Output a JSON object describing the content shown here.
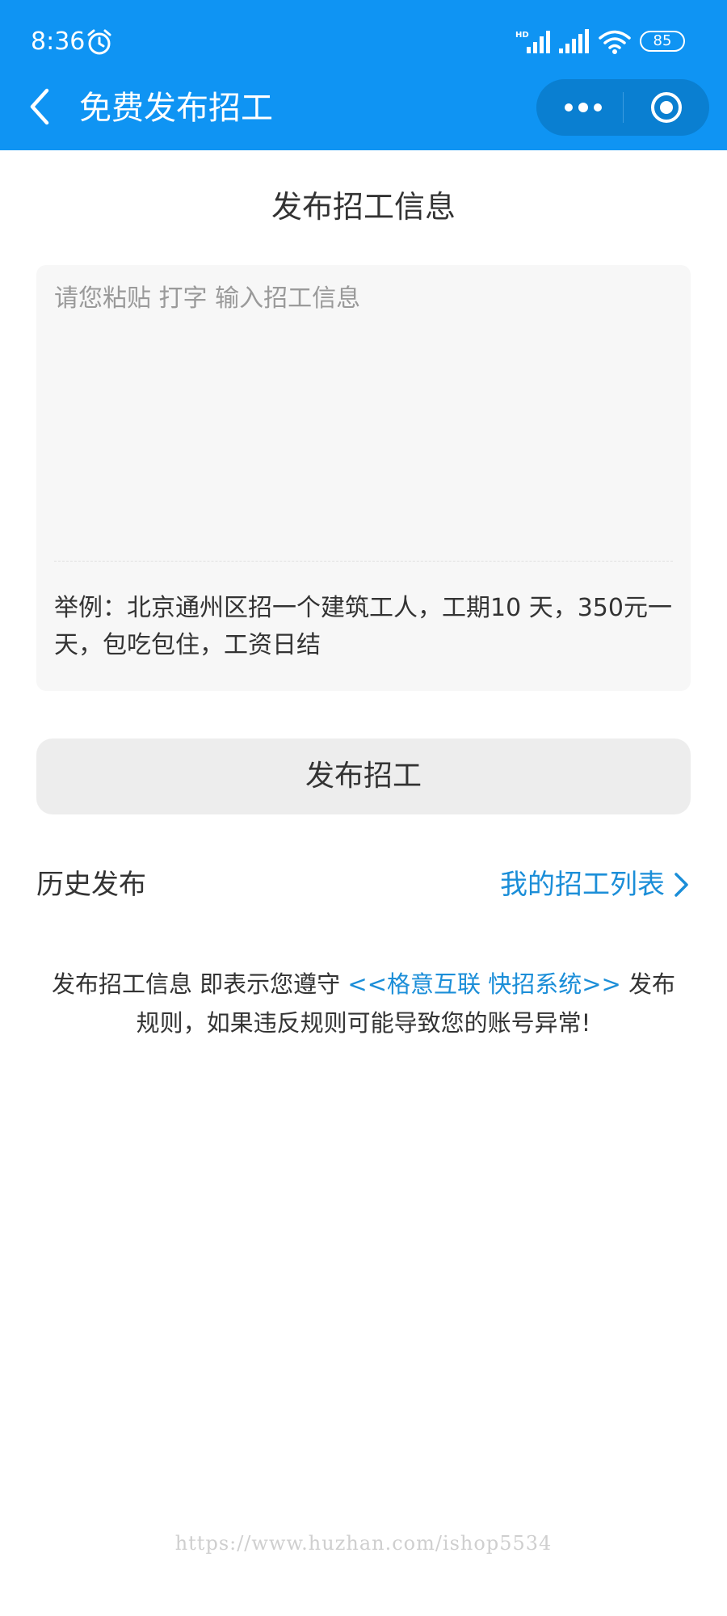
{
  "status_bar": {
    "time": "8:36",
    "battery": "85",
    "icons": [
      "alarm-icon",
      "signal-hd-icon",
      "signal-icon",
      "wifi-icon",
      "battery-icon"
    ]
  },
  "nav_bar": {
    "title": "免费发布招工",
    "icons": [
      "back-icon",
      "more-icon",
      "close-icon"
    ]
  },
  "form": {
    "heading": "发布招工信息",
    "placeholder": "请您粘贴 打字 输入招工信息",
    "example": "举例：北京通州区招一个建筑工人，工期10 天，350元一天，包吃包住，工资日结"
  },
  "actions": {
    "publish_label": "发布招工"
  },
  "history": {
    "label": "历史发布",
    "link_label": "我的招工列表"
  },
  "agreement": {
    "prefix": "发布招工信息 即表示您遵守 ",
    "link": "<<格意互联 快招系统>>",
    "suffix": " 发布规则，如果违反规则可能导致您的账号异常!"
  },
  "watermark": "https://www.huzhan.com/ishop5534",
  "colors": {
    "header_bg": "#0f94f3",
    "link": "#1b8ed8",
    "card_bg": "#f7f7f7",
    "button_bg": "#ededed"
  }
}
